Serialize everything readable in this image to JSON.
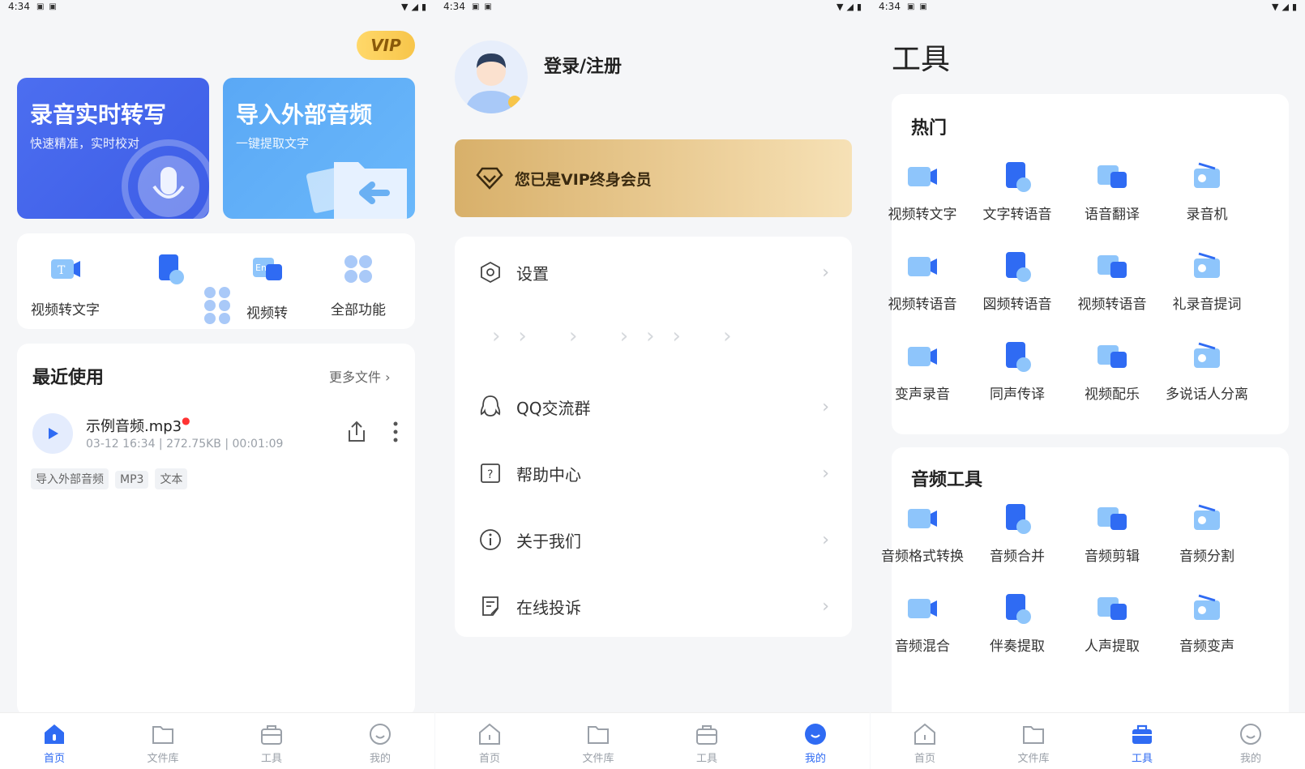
{
  "status": {
    "time": "4:34"
  },
  "home": {
    "vip_badge": "VIP",
    "banner_record": {
      "title": "录音实时转写",
      "subtitle": "快速精准，实时校对"
    },
    "banner_import": {
      "title": "导入外部音频",
      "subtitle": "一键提取文字"
    },
    "quick": [
      "视频转文字",
      "视频转",
      "全部功能"
    ],
    "recent_title": "最近使用",
    "more_files": "更多文件",
    "file": {
      "name": "示例音频.mp3",
      "date": "03-12 16:34",
      "size": "272.75KB",
      "duration": "00:01:09",
      "tags": [
        "导入外部音频",
        "MP3",
        "文本"
      ]
    }
  },
  "me": {
    "login": "登录/注册",
    "vip_text": "您已是VIP终身会员",
    "menu": [
      "设置",
      "QQ交流群",
      "帮助中心",
      "关于我们",
      "在线投诉"
    ]
  },
  "tools": {
    "title": "工具",
    "hot_title": "热门",
    "hot": [
      "视频转文字",
      "文字转语音",
      "语音翻译",
      "录音机",
      "视频转语音",
      "図频转语音",
      "视频转语音",
      "礼录音提词",
      "变声录音",
      "同声传译",
      "视频配乐",
      "多说话人分离"
    ],
    "audio_title": "音频工具",
    "audio": [
      "音频格式转换",
      "音频合并",
      "音频剪辑",
      "音频分割",
      "音频混合",
      "伴奏提取",
      "人声提取",
      "音频变声"
    ]
  },
  "nav": [
    "首页",
    "文件库",
    "工具",
    "我的"
  ],
  "colors": {
    "primary": "#2f6bf3",
    "vip_gold": "#e6c07e"
  }
}
